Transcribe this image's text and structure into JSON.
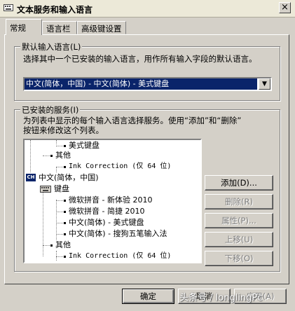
{
  "window": {
    "title": "文本服务和输入语言",
    "close_label": "×"
  },
  "tabs": [
    {
      "label": "常规",
      "active": true
    },
    {
      "label": "语言栏",
      "active": false
    },
    {
      "label": "高级键设置",
      "active": false
    }
  ],
  "default_language": {
    "group_label": "默认输入语言(L)",
    "description": "选择其中一个已安装的输入语言，用作所有输入字段的默认语言。",
    "selected_value": "中文(简体，中国) - 中文(简体) - 美式键盘",
    "dropdown_icon": "chevron-down-icon"
  },
  "installed_services": {
    "group_label": "已安装的服务(I)",
    "description_line1": "为列表中显示的每个输入语言选择服务。使用“添加”和“删除”",
    "description_line2": "按钮来修改这个列表。",
    "tree": {
      "item_us_keyboard_top": "美式键盘",
      "other_top": "其他",
      "ink_top": "Ink Correction (仅 64 位)",
      "lang_badge": "CH",
      "lang_label": "中文(简体，中国)",
      "keyboard_label": "键盘",
      "kb_items": [
        "微软拼音 - 新体验 2010",
        "微软拼音 - 简捷 2010",
        "中文(简体) - 美式键盘",
        "中文(简体) - 搜狗五笔输入法"
      ],
      "other_bottom": "其他",
      "ink_bottom": "Ink Correction (仅 64 位)"
    },
    "buttons": {
      "add": "添加(D)...",
      "remove": "删除(R)",
      "properties": "属性(P)...",
      "move_up": "上移(U)",
      "move_down": "下移(O)"
    }
  },
  "footer": {
    "ok": "确定",
    "cancel": "取消",
    "apply": "应用(A)"
  },
  "watermark": "头条号 / longlingPc"
}
